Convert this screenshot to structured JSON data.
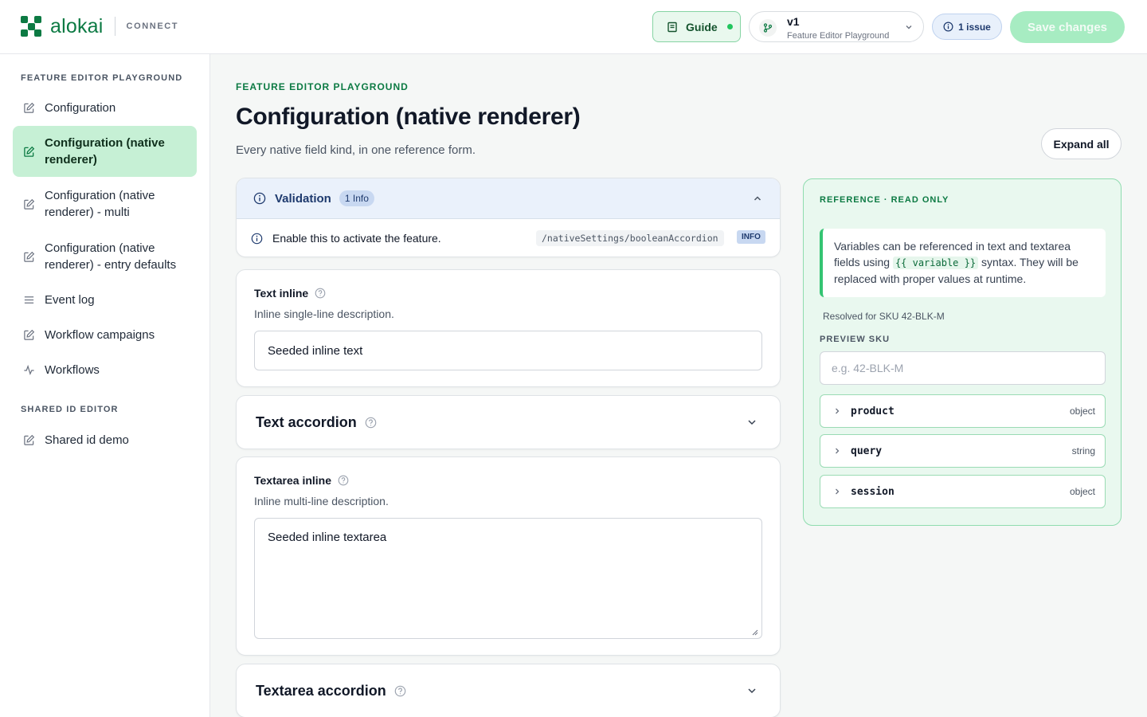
{
  "header": {
    "brand": "alokai",
    "brand_sub": "CONNECT",
    "guide_label": "Guide",
    "version": {
      "name": "v1",
      "subtitle": "Feature Editor Playground"
    },
    "issues_label": "1 issue",
    "save_label": "Save changes",
    "colors": {
      "brand": "#0c7a43",
      "save_disabled": "#a7ecc2"
    }
  },
  "sidebar": {
    "sections": [
      {
        "title": "FEATURE EDITOR PLAYGROUND",
        "items": [
          {
            "label": "Configuration",
            "icon": "edit-icon"
          },
          {
            "label": "Configuration (native renderer)",
            "icon": "edit-icon",
            "active": true
          },
          {
            "label": "Configuration (native renderer) - multi",
            "icon": "edit-icon"
          },
          {
            "label": "Configuration (native renderer) - entry defaults",
            "icon": "edit-icon"
          },
          {
            "label": "Event log",
            "icon": "list-icon"
          },
          {
            "label": "Workflow campaigns",
            "icon": "edit-icon"
          },
          {
            "label": "Workflows",
            "icon": "activity-icon"
          }
        ]
      },
      {
        "title": "SHARED ID EDITOR",
        "items": [
          {
            "label": "Shared id demo",
            "icon": "edit-icon"
          }
        ]
      }
    ]
  },
  "main": {
    "eyebrow": "FEATURE EDITOR PLAYGROUND",
    "title": "Configuration (native renderer)",
    "description": "Every native field kind, in one reference form.",
    "expand_all_label": "Expand all",
    "validation": {
      "title": "Validation",
      "badge": "1 Info",
      "items": [
        {
          "message": "Enable this to activate the feature.",
          "path": "/nativeSettings/booleanAccordion",
          "level": "INFO"
        }
      ]
    },
    "fields": {
      "text_inline": {
        "label": "Text inline",
        "description": "Inline single-line description.",
        "value": "Seeded inline text"
      },
      "text_accordion": {
        "label": "Text accordion"
      },
      "textarea_inline": {
        "label": "Textarea inline",
        "description": "Inline multi-line description.",
        "value": "Seeded inline textarea"
      },
      "textarea_accordion": {
        "label": "Textarea accordion"
      }
    }
  },
  "reference": {
    "eyebrow": "REFERENCE · READ ONLY",
    "note_before": "Variables can be referenced in text and textarea fields using ",
    "note_code": "{{ variable }}",
    "note_after": " syntax. They will be replaced with proper values at runtime.",
    "resolved": "Resolved for SKU 42-BLK-M",
    "preview_label": "PREVIEW SKU",
    "preview_placeholder": "e.g. 42-BLK-M",
    "variables": [
      {
        "name": "product",
        "type": "object"
      },
      {
        "name": "query",
        "type": "string"
      },
      {
        "name": "session",
        "type": "object"
      }
    ]
  }
}
